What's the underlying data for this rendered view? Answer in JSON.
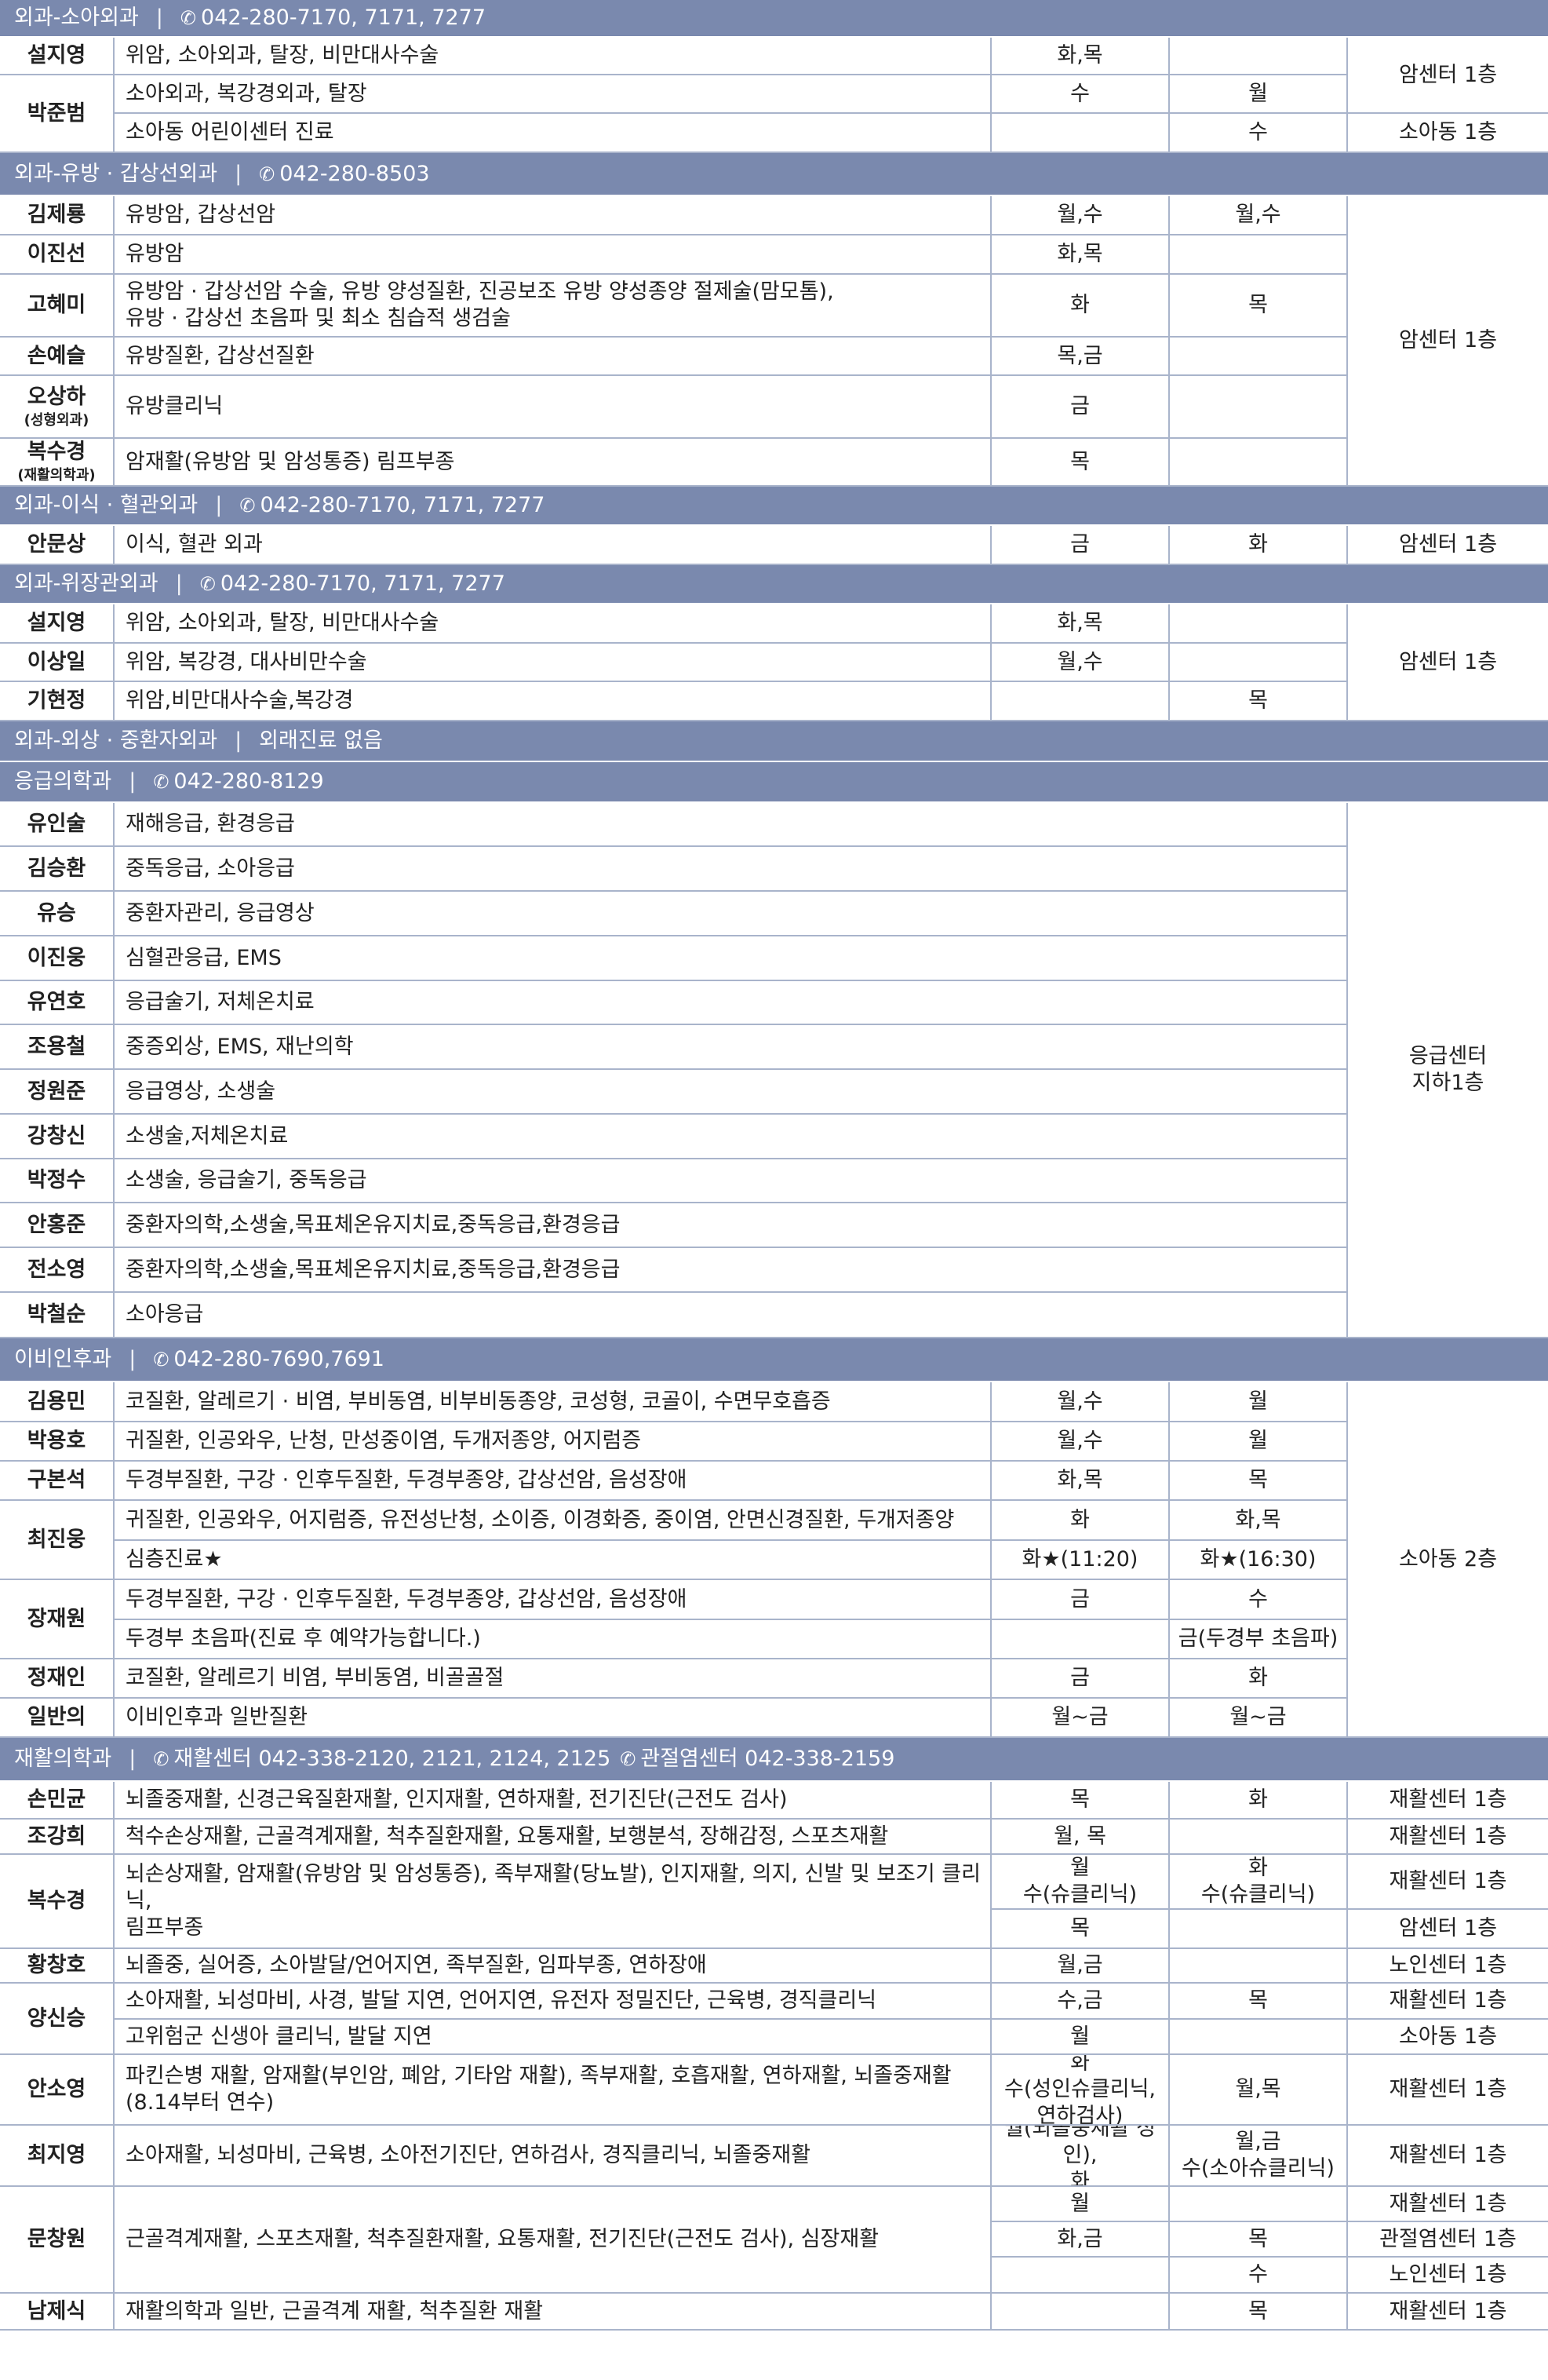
{
  "colors": {
    "section_bg": "#7a89ae",
    "border": "#a9b4cb",
    "section_text": "#ffffff"
  },
  "sections": [
    {
      "name": "외과-소아외과",
      "phone": "042-280-7170, 7171, 7277",
      "rows": [
        {
          "name": "설지영",
          "desc": "위암, 소아외과, 탈장, 비만대사수술",
          "am": "화,목",
          "pm": "",
          "loc": "암센터 1층"
        },
        {
          "name": "박준범",
          "desc": "소아외과, 복강경외과, 탈장",
          "am": "수",
          "pm": "월",
          "loc": ""
        },
        {
          "name": "",
          "desc": "소아동 어린이센터 진료",
          "am": "",
          "pm": "수",
          "loc": "소아동 1층"
        }
      ]
    },
    {
      "name": "외과-유방 · 갑상선외과",
      "phone": "042-280-8503",
      "rows": [
        {
          "name": "김제룡",
          "desc": "유방암, 갑상선암",
          "am": "월,수",
          "pm": "월,수",
          "loc": "암센터 1층"
        },
        {
          "name": "이진선",
          "desc": "유방암",
          "am": "화,목",
          "pm": "",
          "loc": ""
        },
        {
          "name": "고혜미",
          "desc": "유방암 · 갑상선암 수술, 유방 양성질환, 진공보조 유방 양성종양 절제술(맘모톰),\n유방 · 갑상선 초음파 및 최소 침습적 생검술",
          "am": "화",
          "pm": "목",
          "loc": ""
        },
        {
          "name": "손예슬",
          "desc": "유방질환, 갑상선질환",
          "am": "목,금",
          "pm": "",
          "loc": ""
        },
        {
          "name": "오상하",
          "name_sub": "(성형외과)",
          "desc": "유방클리닉",
          "am": "금",
          "pm": "",
          "loc": ""
        },
        {
          "name": "복수경",
          "name_sub": "(재활의학과)",
          "desc": "암재활(유방암 및 암성통증) 림프부종",
          "am": "목",
          "pm": "",
          "loc": ""
        }
      ]
    },
    {
      "name": "외과-이식 · 혈관외과",
      "phone": "042-280-7170, 7171, 7277",
      "rows": [
        {
          "name": "안문상",
          "desc": "이식, 혈관 외과",
          "am": "금",
          "pm": "화",
          "loc": "암센터 1층"
        }
      ]
    },
    {
      "name": "외과-위장관외과",
      "phone": "042-280-7170, 7171, 7277",
      "rows": [
        {
          "name": "설지영",
          "desc": "위암, 소아외과, 탈장, 비만대사수술",
          "am": "화,목",
          "pm": "",
          "loc": "암센터 1층"
        },
        {
          "name": "이상일",
          "desc": "위암, 복강경, 대사비만수술",
          "am": "월,수",
          "pm": "",
          "loc": ""
        },
        {
          "name": "기현정",
          "desc": "위암,비만대사수술,복강경",
          "am": "",
          "pm": "목",
          "loc": ""
        }
      ]
    },
    {
      "name": "외과-외상 · 중환자외과",
      "phone": "외래진료 없음",
      "no_phone_icon": true,
      "rows": []
    },
    {
      "name": "응급의학과",
      "phone": "042-280-8129",
      "rows": [
        {
          "name": "유인술",
          "desc": "재해응급, 환경응급",
          "loc": "응급센터\n지하1층"
        },
        {
          "name": "김승환",
          "desc": "중독응급, 소아응급"
        },
        {
          "name": "유승",
          "desc": "중환자관리, 응급영상"
        },
        {
          "name": "이진웅",
          "desc": "심혈관응급, EMS"
        },
        {
          "name": "유연호",
          "desc": "응급술기, 저체온치료"
        },
        {
          "name": "조용철",
          "desc": "중증외상, EMS, 재난의학"
        },
        {
          "name": "정원준",
          "desc": "응급영상, 소생술"
        },
        {
          "name": "강창신",
          "desc": "소생술,저체온치료"
        },
        {
          "name": "박정수",
          "desc": "소생술, 응급술기, 중독응급"
        },
        {
          "name": "안홍준",
          "desc": "중환자의학,소생술,목표체온유지치료,중독응급,환경응급"
        },
        {
          "name": "전소영",
          "desc": "중환자의학,소생술,목표체온유지치료,중독응급,환경응급"
        },
        {
          "name": "박철순",
          "desc": "소아응급"
        }
      ]
    },
    {
      "name": "이비인후과",
      "phone": "042-280-7690,7691",
      "rows": [
        {
          "name": "김용민",
          "desc": "코질환, 알레르기 · 비염, 부비동염, 비부비동종양, 코성형, 코골이, 수면무호흡증",
          "am": "월,수",
          "pm": "월",
          "loc": "소아동 2층"
        },
        {
          "name": "박용호",
          "desc": "귀질환, 인공와우, 난청, 만성중이염, 두개저종양, 어지럼증",
          "am": "월,수",
          "pm": "월"
        },
        {
          "name": "구본석",
          "desc": "두경부질환, 구강 · 인후두질환, 두경부종양, 갑상선암, 음성장애",
          "am": "화,목",
          "pm": "목"
        },
        {
          "name": "최진웅",
          "desc": "귀질환, 인공와우, 어지럼증, 유전성난청, 소이증, 이경화증, 중이염, 안면신경질환, 두개저종양",
          "am": "화",
          "pm": "화,목"
        },
        {
          "name": "",
          "desc": "심층진료★",
          "am": "화★(11:20)",
          "pm": "화★(16:30)"
        },
        {
          "name": "장재원",
          "desc": "두경부질환, 구강 · 인후두질환, 두경부종양, 갑상선암, 음성장애",
          "am": "금",
          "pm": "수"
        },
        {
          "name": "",
          "desc": "두경부 초음파(진료 후 예약가능합니다.)",
          "am": "",
          "pm": "금(두경부 초음파)"
        },
        {
          "name": "정재인",
          "desc": "코질환, 알레르기 비염, 부비동염, 비골골절",
          "am": "금",
          "pm": "화"
        },
        {
          "name": "일반의",
          "desc": "이비인후과 일반질환",
          "am": "월~금",
          "pm": "월~금"
        }
      ]
    },
    {
      "name": "재활의학과",
      "phone": "재활센터 042-338-2120, 2121, 2124, 2125",
      "phone2": "관절염센터 042-338-2159",
      "rows": [
        {
          "name": "손민균",
          "desc": "뇌졸중재활, 신경근육질환재활, 인지재활, 연하재활, 전기진단(근전도 검사)",
          "am": "목",
          "pm": "화",
          "loc": "재활센터 1층"
        },
        {
          "name": "조강희",
          "desc": "척수손상재활, 근골격계재활, 척추질환재활, 요통재활, 보행분석, 장해감정, 스포츠재활",
          "am": "월, 목",
          "pm": "",
          "loc": "재활센터 1층"
        },
        {
          "name": "복수경",
          "desc": "뇌손상재활, 암재활(유방암 및 암성통증), 족부재활(당뇨발), 인지재활, 의지, 신발 및 보조기 클리닉,\n림프부종",
          "am": "월\n수(슈클리닉)",
          "pm": "화\n수(슈클리닉)",
          "loc": "재활센터 1층"
        },
        {
          "name": "",
          "desc": "",
          "am": "목",
          "pm": "",
          "loc": "암센터 1층"
        },
        {
          "name": "황창호",
          "desc": "뇌졸중, 실어증, 소아발달/언어지연, 족부질환, 임파부종, 연하장애",
          "am": "월,금",
          "pm": "",
          "loc": "노인센터 1층"
        },
        {
          "name": "양신승",
          "desc": "소아재활, 뇌성마비, 사경, 발달 지연, 언어지연, 유전자 정밀진단, 근육병, 경직클리닉",
          "am": "수,금",
          "pm": "목",
          "loc": "재활센터 1층"
        },
        {
          "name": "",
          "desc": "고위험군 신생아 클리닉, 발달 지연",
          "am": "월",
          "pm": "",
          "loc": "소아동 1층"
        },
        {
          "name": "안소영",
          "desc": "파킨슨병 재활, 암재활(부인암, 폐암, 기타암 재활), 족부재활, 호흡재활, 연하재활, 뇌졸중재활\n(8.14부터 연수)",
          "am": "화\n수(성인슈클리닉,\n연하검사)",
          "pm": "월,목",
          "loc": "재활센터 1층"
        },
        {
          "name": "최지영",
          "desc": "소아재활, 뇌성마비, 근육병, 소아전기진단, 연하검사, 경직클리닉, 뇌졸중재활",
          "am": "월(뇌졸중재활 성인),\n화",
          "pm": "월,금\n수(소아슈클리닉)",
          "loc": "재활센터 1층"
        },
        {
          "name": "문창원",
          "desc": "근골격계재활, 스포츠재활, 척추질환재활, 요통재활, 전기진단(근전도 검사), 심장재활",
          "am": "월",
          "pm": "",
          "loc": "재활센터 1층"
        },
        {
          "name": "",
          "desc": "",
          "am": "화,금",
          "pm": "목",
          "loc": "관절염센터 1층"
        },
        {
          "name": "",
          "desc": "",
          "am": "",
          "pm": "수",
          "loc": "노인센터 1층"
        },
        {
          "name": "남제식",
          "desc": "재활의학과 일반, 근골격계 재활, 척추질환 재활",
          "am": "",
          "pm": "목",
          "loc": "재활센터 1층"
        }
      ]
    }
  ]
}
